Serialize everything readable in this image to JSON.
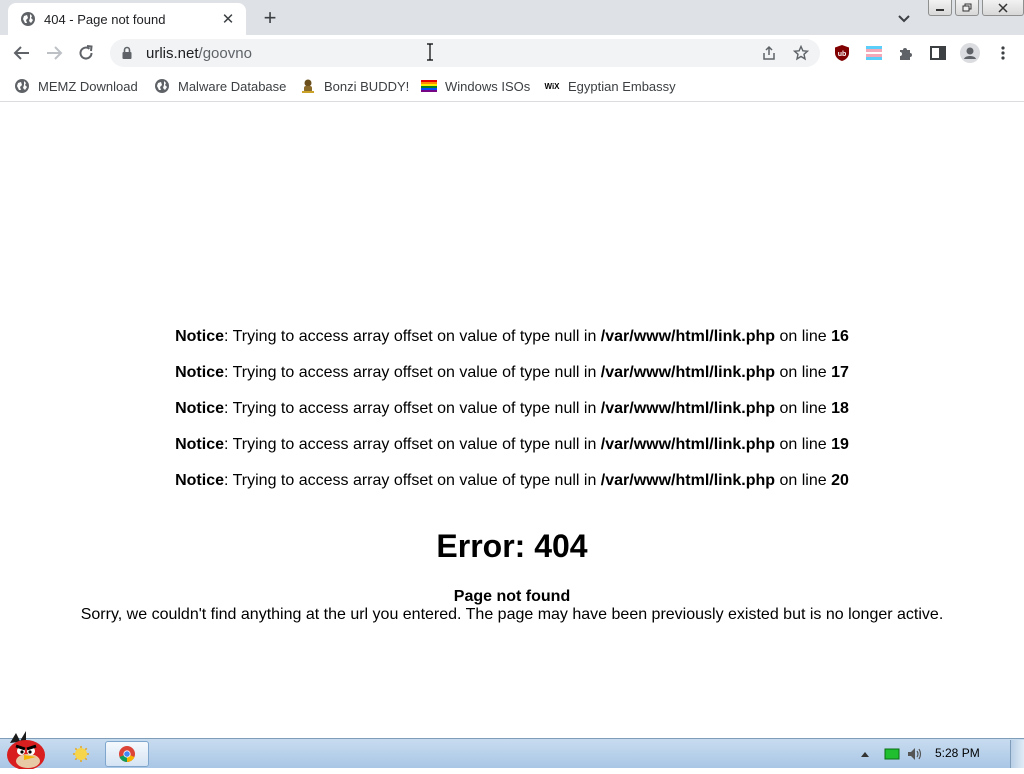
{
  "browser": {
    "tab": {
      "title": "404 - Page not found",
      "close_glyph": "✕"
    },
    "new_tab_glyph": "+",
    "address": {
      "domain": "urlis.net",
      "path": "/goovno"
    },
    "bookmarks": [
      {
        "label": "MEMZ Download",
        "icon": "globe-icon"
      },
      {
        "label": "Malware Database",
        "icon": "globe-icon"
      },
      {
        "label": "Bonzi BUDDY!",
        "icon": "bonzi-icon"
      },
      {
        "label": "Windows ISOs",
        "icon": "rainbow-flag-icon"
      },
      {
        "label": "Egyptian Embassy",
        "icon": "wix-icon"
      }
    ],
    "wix_text": "WiX"
  },
  "page": {
    "notices": [
      {
        "label": "Notice",
        "message": ": Trying to access array offset on value of type null in ",
        "file": "/var/www/html/link.php",
        "on_line": " on line ",
        "line": "16"
      },
      {
        "label": "Notice",
        "message": ": Trying to access array offset on value of type null in ",
        "file": "/var/www/html/link.php",
        "on_line": " on line ",
        "line": "17"
      },
      {
        "label": "Notice",
        "message": ": Trying to access array offset on value of type null in ",
        "file": "/var/www/html/link.php",
        "on_line": " on line ",
        "line": "18"
      },
      {
        "label": "Notice",
        "message": ": Trying to access array offset on value of type null in ",
        "file": "/var/www/html/link.php",
        "on_line": " on line ",
        "line": "19"
      },
      {
        "label": "Notice",
        "message": ": Trying to access array offset on value of type null in ",
        "file": "/var/www/html/link.php",
        "on_line": " on line ",
        "line": "20"
      }
    ],
    "error_title": "Error: 404",
    "error_subtitle": "Page not found",
    "error_description": "Sorry, we couldn't find anything at the url you entered. The page may have been previously existed but is no longer active."
  },
  "taskbar": {
    "clock": "5:28 PM"
  },
  "colors": {
    "tabstrip": "#dee1e6",
    "omnibox": "#f1f3f4",
    "ublock_red": "#800000",
    "taskbar": "#a9c6e6"
  }
}
